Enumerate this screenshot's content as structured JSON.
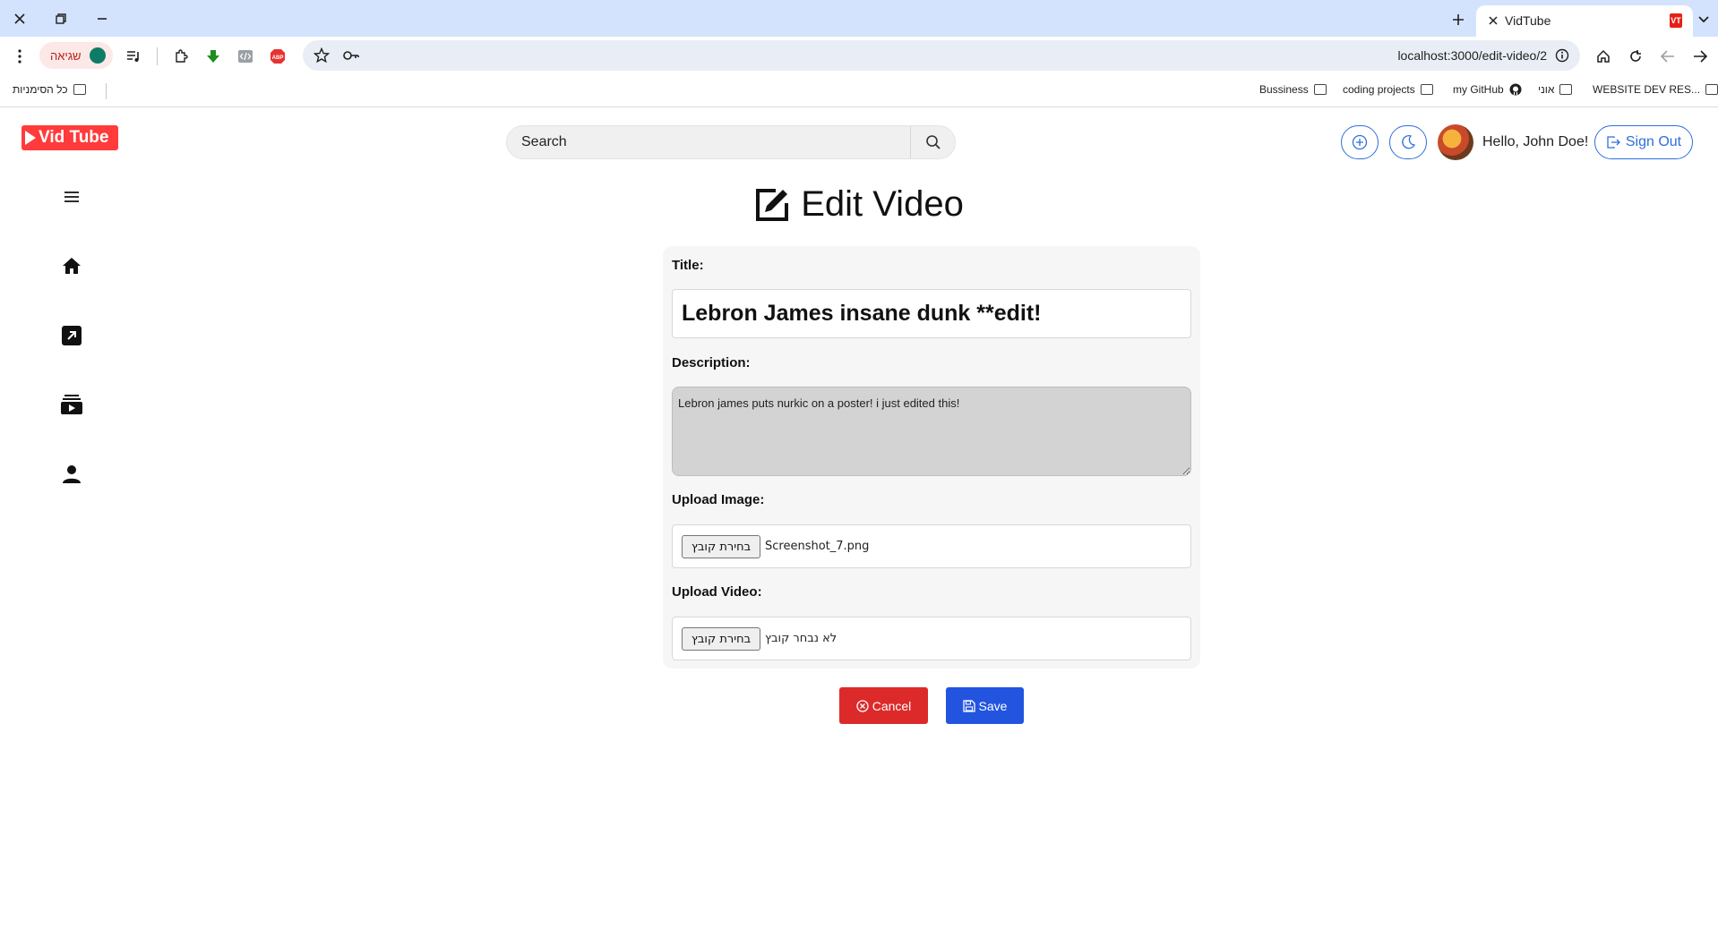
{
  "browser": {
    "tab_title": "VidTube",
    "tab_favicon_text": "VT",
    "url": "localhost:3000/edit-video/2",
    "error_chip_label": "שגיאה",
    "bookmarks": {
      "all_bookmarks": "כל הסימניות",
      "items": [
        "WEBSITE DEV RES...",
        "אוני",
        "my GitHub",
        "coding projects",
        "Bussiness"
      ]
    }
  },
  "header": {
    "logo_text": "Vid Tube",
    "search_placeholder": "Search",
    "greeting": "Hello, John Doe!",
    "sign_out_label": "Sign Out"
  },
  "sidebar": {
    "items": [
      "menu-icon",
      "home-icon",
      "trending-icon",
      "subscriptions-icon",
      "profile-icon"
    ]
  },
  "page": {
    "title": "Edit Video"
  },
  "form": {
    "title_label": "Title:",
    "title_value": "Lebron James insane dunk **edit!",
    "description_label": "Description:",
    "description_value": "Lebron james puts nurkic on a poster! i just edited this!",
    "image_label": "Upload Image:",
    "image_button": "בחירת קובץ",
    "image_file": "Screenshot_7.png",
    "video_label": "Upload Video:",
    "video_button": "בחירת קובץ",
    "video_file": "לא נבחר קובץ"
  },
  "actions": {
    "cancel_label": "Cancel",
    "save_label": "Save"
  },
  "colors": {
    "accent": "#2f6fdc",
    "logo": "#ff3b3b",
    "cancel": "#dc2a2a",
    "save": "#2354e0"
  }
}
